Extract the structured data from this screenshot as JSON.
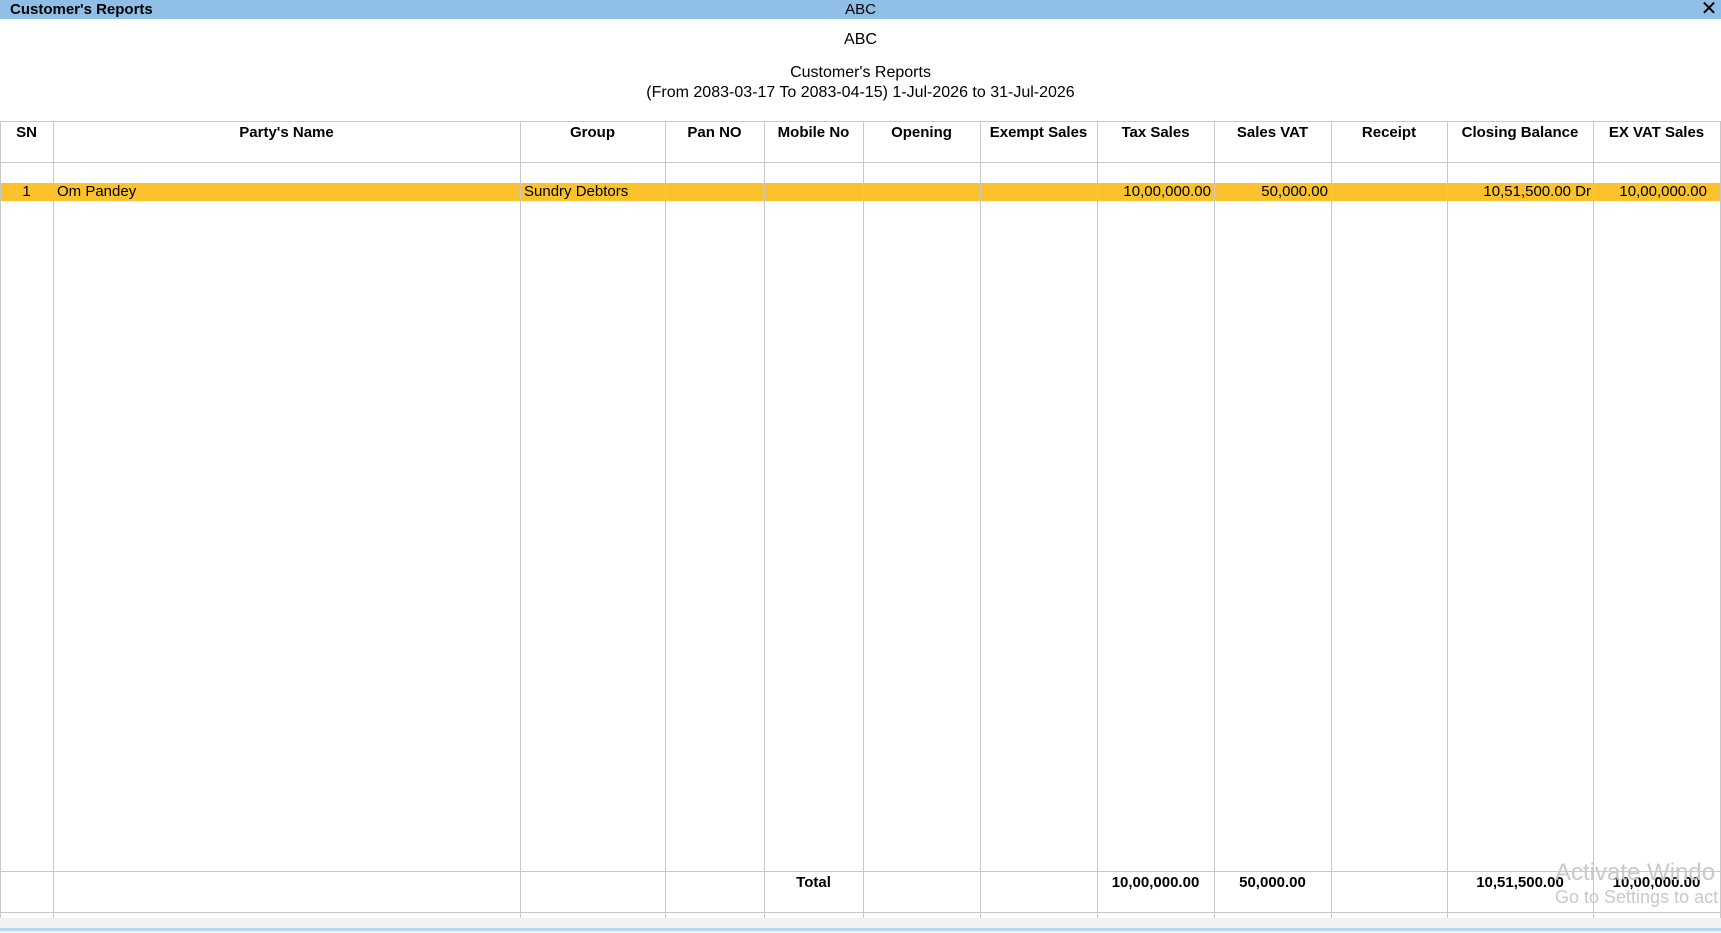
{
  "window": {
    "title": "Customer's Reports",
    "company": "ABC",
    "close_glyph": "✕"
  },
  "report": {
    "company": "ABC",
    "title": "Customer's Reports",
    "period": "(From 2083-03-17 To 2083-04-15) 1-Jul-2026 to 31-Jul-2026"
  },
  "columns": [
    "SN",
    "Party's Name",
    "Group",
    "Pan NO",
    "Mobile No",
    "Opening",
    "Exempt Sales",
    "Tax Sales",
    "Sales VAT",
    "Receipt",
    "Closing Balance",
    "EX VAT Sales"
  ],
  "rows": [
    {
      "sn": "1",
      "party": "Om Pandey",
      "group": "Sundry Debtors",
      "pan": "",
      "mobile": "",
      "opening": "",
      "exempt": "",
      "tax_sales": "10,00,000.00",
      "sales_vat": "50,000.00",
      "receipt": "",
      "closing": "10,51,500.00 Dr",
      "ex_vat": "10,00,000.00"
    }
  ],
  "totals": {
    "label": "Total",
    "tax_sales": "10,00,000.00",
    "sales_vat": "50,000.00",
    "closing": "10,51,500.00",
    "ex_vat": "10,00,000.00"
  },
  "watermark": {
    "line1": "Activate Windo",
    "line2": "Go to Settings to act"
  },
  "colors": {
    "titlebar": "#8fbfe6",
    "selected_row": "#fcc22e",
    "grid_line": "#c8c8c8"
  }
}
